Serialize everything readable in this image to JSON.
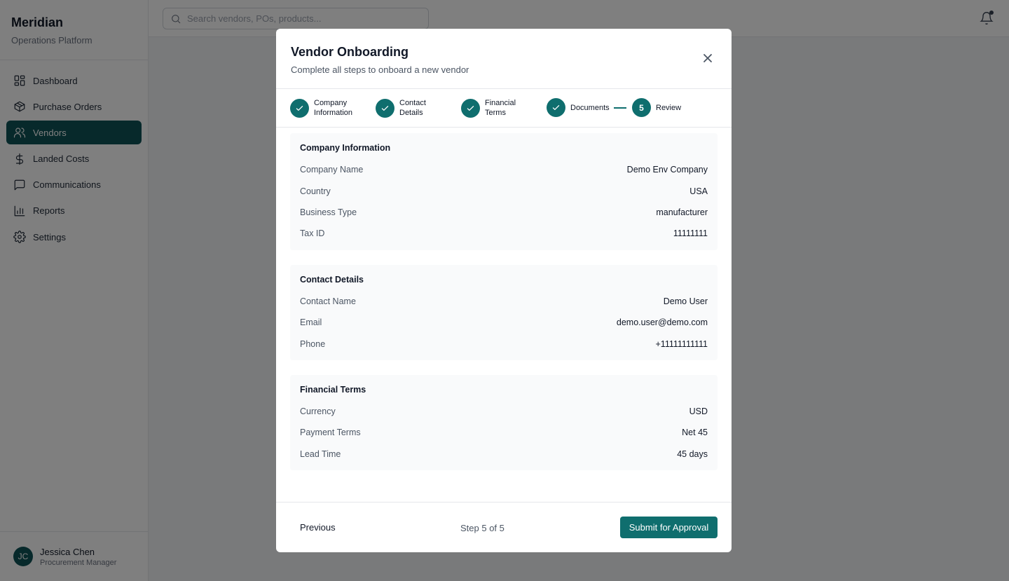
{
  "brand": {
    "name": "Meridian",
    "subtitle": "Operations Platform"
  },
  "sidebar": {
    "items": [
      {
        "label": "Dashboard",
        "icon": "dashboard-icon"
      },
      {
        "label": "Purchase Orders",
        "icon": "package-icon"
      },
      {
        "label": "Vendors",
        "icon": "users-icon",
        "active": true
      },
      {
        "label": "Landed Costs",
        "icon": "dollar-icon"
      },
      {
        "label": "Communications",
        "icon": "message-icon"
      },
      {
        "label": "Reports",
        "icon": "bar-chart-icon"
      },
      {
        "label": "Settings",
        "icon": "gear-icon"
      }
    ]
  },
  "user": {
    "initials": "JC",
    "name": "Jessica Chen",
    "role": "Procurement Manager"
  },
  "search": {
    "placeholder": "Search vendors, POs, products..."
  },
  "modal": {
    "title": "Vendor Onboarding",
    "subtitle": "Complete all steps to onboard a new vendor",
    "steps": [
      {
        "label_line1": "Company",
        "label_line2": "Information",
        "status": "complete"
      },
      {
        "label_line1": "Contact",
        "label_line2": "Details",
        "status": "complete"
      },
      {
        "label_line1": "Financial",
        "label_line2": "Terms",
        "status": "complete"
      },
      {
        "label_line1": "Documents",
        "label_line2": "",
        "status": "complete"
      },
      {
        "number": "5",
        "label_line1": "Review",
        "label_line2": "",
        "status": "current"
      }
    ],
    "sections": {
      "company": {
        "title": "Company Information",
        "rows": [
          {
            "label": "Company Name",
            "value": "Demo Env Company"
          },
          {
            "label": "Country",
            "value": "USA"
          },
          {
            "label": "Business Type",
            "value": "manufacturer"
          },
          {
            "label": "Tax ID",
            "value": "11111111"
          }
        ]
      },
      "contact": {
        "title": "Contact Details",
        "rows": [
          {
            "label": "Contact Name",
            "value": "Demo User"
          },
          {
            "label": "Email",
            "value": "demo.user@demo.com"
          },
          {
            "label": "Phone",
            "value": "+11111111111"
          }
        ]
      },
      "financial": {
        "title": "Financial Terms",
        "rows": [
          {
            "label": "Currency",
            "value": "USD"
          },
          {
            "label": "Payment Terms",
            "value": "Net 45"
          },
          {
            "label": "Lead Time",
            "value": "45 days"
          }
        ]
      }
    },
    "footer": {
      "previous_label": "Previous",
      "step_text": "Step 5 of 5",
      "submit_label": "Submit for Approval"
    }
  },
  "colors": {
    "accent": "#0f6e6e",
    "nav_active": "#0f5257",
    "overlay": "rgba(0,0,0,0.5)"
  }
}
